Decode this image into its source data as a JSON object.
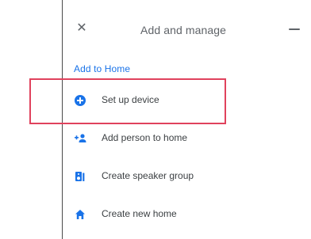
{
  "topbar": {
    "close_icon": "close-icon",
    "title": "Add and manage",
    "more_icon": "more-icon"
  },
  "section": {
    "label": "Add to Home"
  },
  "menu": {
    "items": [
      {
        "label": "Set up device",
        "icon": "add-circle-icon"
      },
      {
        "label": "Add person to home",
        "icon": "add-person-icon"
      },
      {
        "label": "Create speaker group",
        "icon": "speaker-group-icon"
      },
      {
        "label": "Create new home",
        "icon": "home-icon"
      }
    ]
  },
  "colors": {
    "accent": "#1a73e8",
    "highlight": "#e0425d",
    "text": "#3c4043",
    "muted": "#5f6368"
  }
}
